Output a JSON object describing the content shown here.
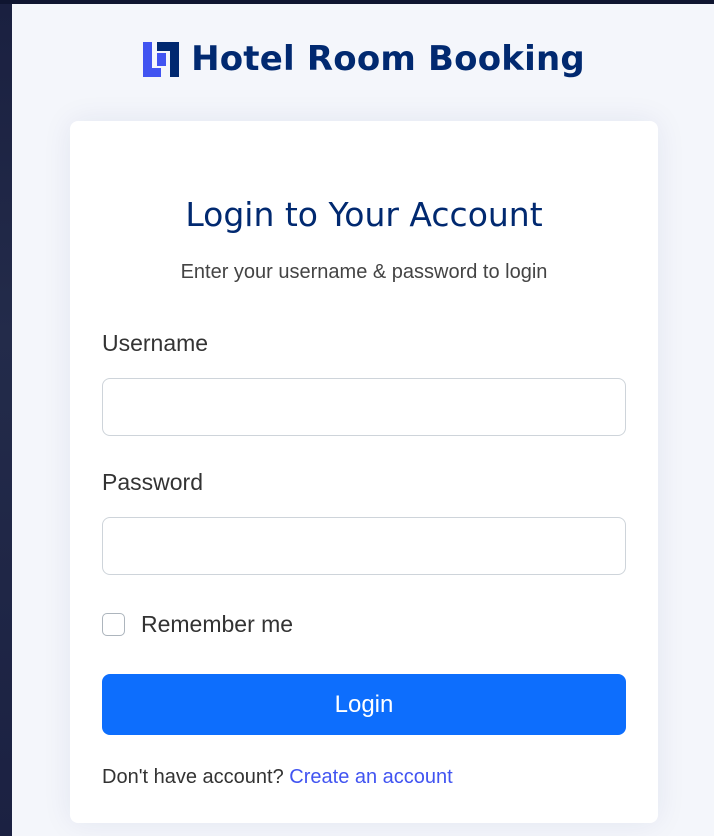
{
  "brand": {
    "logo_icon": "brand-logo-icon",
    "name": "Hotel Room Booking",
    "color": "#012970"
  },
  "login": {
    "title": "Login to Your Account",
    "subtitle": "Enter your username & password to login",
    "username_label": "Username",
    "username_value": "",
    "password_label": "Password",
    "password_value": "",
    "remember_label": "Remember me",
    "remember_checked": false,
    "submit_label": "Login",
    "footer_text": "Don't have account?",
    "footer_link": "Create an account"
  },
  "colors": {
    "primary_button": "#0d6efd",
    "link": "#4154f1",
    "title": "#012970"
  }
}
